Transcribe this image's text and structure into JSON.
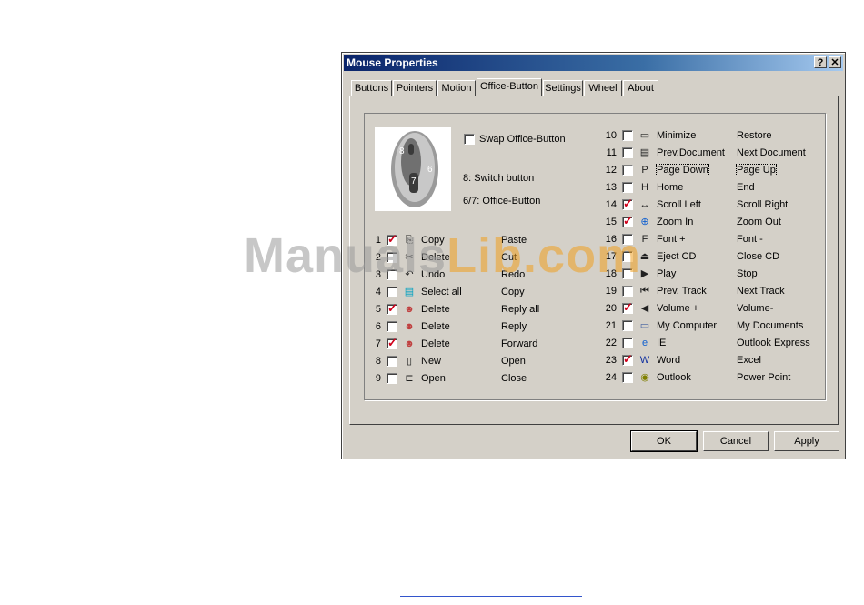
{
  "window": {
    "title": "Mouse Properties",
    "help_label": "?",
    "close_label": "✕"
  },
  "tabs": [
    "Buttons",
    "Pointers",
    "Motion",
    "Office-Button",
    "Settings",
    "Wheel",
    "About"
  ],
  "swap_label": "Swap Office-Button",
  "swap_checked": false,
  "mouse_labels": {
    "a": "8",
    "b": "6",
    "c": "7"
  },
  "switch_text": "8: Switch button",
  "office_text": "6/7: Office-Button",
  "left_rows": [
    {
      "num": "1",
      "checked": true,
      "icon": "copy-icon",
      "action": "Copy",
      "alt": "Paste"
    },
    {
      "num": "2",
      "checked": false,
      "icon": "cut-icon",
      "action": "Delete",
      "alt": "Cut"
    },
    {
      "num": "3",
      "checked": false,
      "icon": "undo-icon",
      "action": "Undo",
      "alt": "Redo"
    },
    {
      "num": "4",
      "checked": false,
      "icon": "select-all-icon",
      "action": "Select all",
      "alt": "Copy"
    },
    {
      "num": "5",
      "checked": true,
      "icon": "reply-all-icon",
      "action": "Delete",
      "alt": "Reply all"
    },
    {
      "num": "6",
      "checked": false,
      "icon": "reply-icon",
      "action": "Delete",
      "alt": "Reply"
    },
    {
      "num": "7",
      "checked": true,
      "icon": "forward-icon",
      "action": "Delete",
      "alt": "Forward"
    },
    {
      "num": "8",
      "checked": false,
      "icon": "new-icon",
      "action": "New",
      "alt": "Open"
    },
    {
      "num": "9",
      "checked": false,
      "icon": "open-icon",
      "action": "Open",
      "alt": "Close"
    }
  ],
  "right_rows": [
    {
      "num": "10",
      "checked": false,
      "icon": "minimize-icon",
      "action": "Minimize",
      "alt": "Restore"
    },
    {
      "num": "11",
      "checked": false,
      "icon": "document-icon",
      "action": "Prev.Document",
      "alt": "Next Document"
    },
    {
      "num": "12",
      "checked": false,
      "icon": "page-icon",
      "action": "Page Down",
      "alt": "Page Up"
    },
    {
      "num": "13",
      "checked": false,
      "icon": "home-icon",
      "action": "Home",
      "alt": "End"
    },
    {
      "num": "14",
      "checked": true,
      "icon": "scroll-icon",
      "action": "Scroll Left",
      "alt": "Scroll Right"
    },
    {
      "num": "15",
      "checked": true,
      "icon": "zoom-icon",
      "action": "Zoom In",
      "alt": "Zoom Out"
    },
    {
      "num": "16",
      "checked": false,
      "icon": "font-icon",
      "action": "Font +",
      "alt": "Font -"
    },
    {
      "num": "17",
      "checked": false,
      "icon": "eject-icon",
      "action": "Eject CD",
      "alt": "Close CD"
    },
    {
      "num": "18",
      "checked": false,
      "icon": "play-icon",
      "action": "Play",
      "alt": "Stop"
    },
    {
      "num": "19",
      "checked": false,
      "icon": "prev-track-icon",
      "action": "Prev. Track",
      "alt": "Next Track"
    },
    {
      "num": "20",
      "checked": true,
      "icon": "volume-icon",
      "action": "Volume +",
      "alt": "Volume-"
    },
    {
      "num": "21",
      "checked": false,
      "icon": "computer-icon",
      "action": "My Computer",
      "alt": "My Documents"
    },
    {
      "num": "22",
      "checked": false,
      "icon": "ie-icon",
      "action": "IE",
      "alt": "Outlook Express"
    },
    {
      "num": "23",
      "checked": true,
      "icon": "word-icon",
      "action": "Word",
      "alt": "Excel"
    },
    {
      "num": "24",
      "checked": false,
      "icon": "outlook-icon",
      "action": "Outlook",
      "alt": "Power Point"
    }
  ],
  "buttons": {
    "ok": "OK",
    "cancel": "Cancel",
    "apply": "Apply"
  },
  "watermark": "ManualsLib.com"
}
